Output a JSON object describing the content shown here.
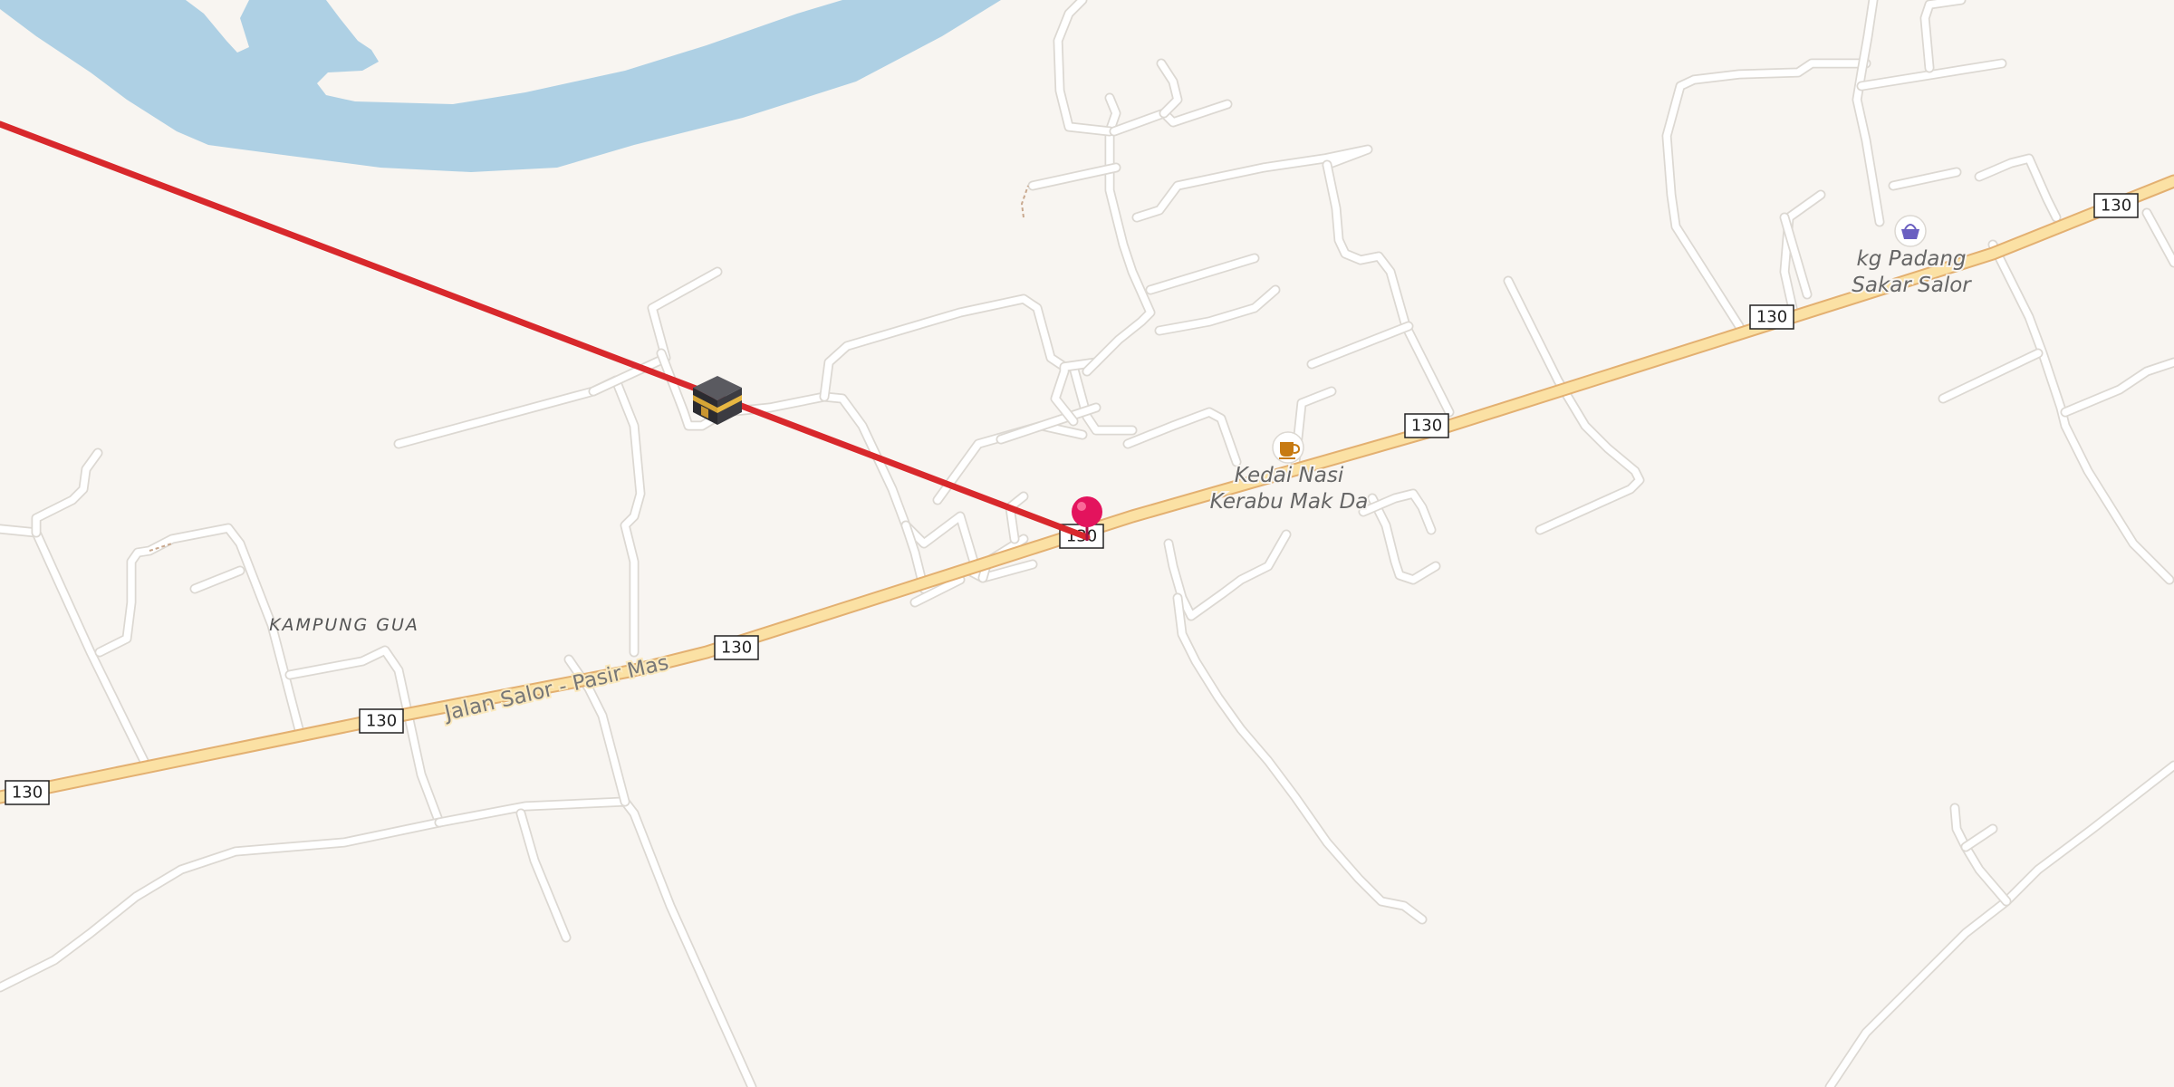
{
  "map": {
    "route_shield": "130",
    "street_name": "Jalan Salor - Pasir Mas",
    "village_name": "KAMPUNG GUA",
    "pois": [
      {
        "name_line1": "Kedai Nasi",
        "name_line2": "Kerabu Mak Da",
        "icon": "cafe-icon"
      },
      {
        "name_line1": "kg Padang",
        "name_line2": "Sakar Salor",
        "icon": "shop-basket-icon"
      }
    ],
    "qibla_icon": "kaaba-icon",
    "location_marker_icon": "location-pin-icon",
    "colors": {
      "land": "#f8f5f1",
      "water": "#aed0e4",
      "main_road": "#fbe1a4",
      "main_road_casing": "#e3b071",
      "minor_road": "#ffffff",
      "qibla_line": "#d8282c",
      "marker": "#e3135d",
      "cafe_icon": "#c77a12",
      "shop_icon": "#6a5fc1"
    }
  }
}
